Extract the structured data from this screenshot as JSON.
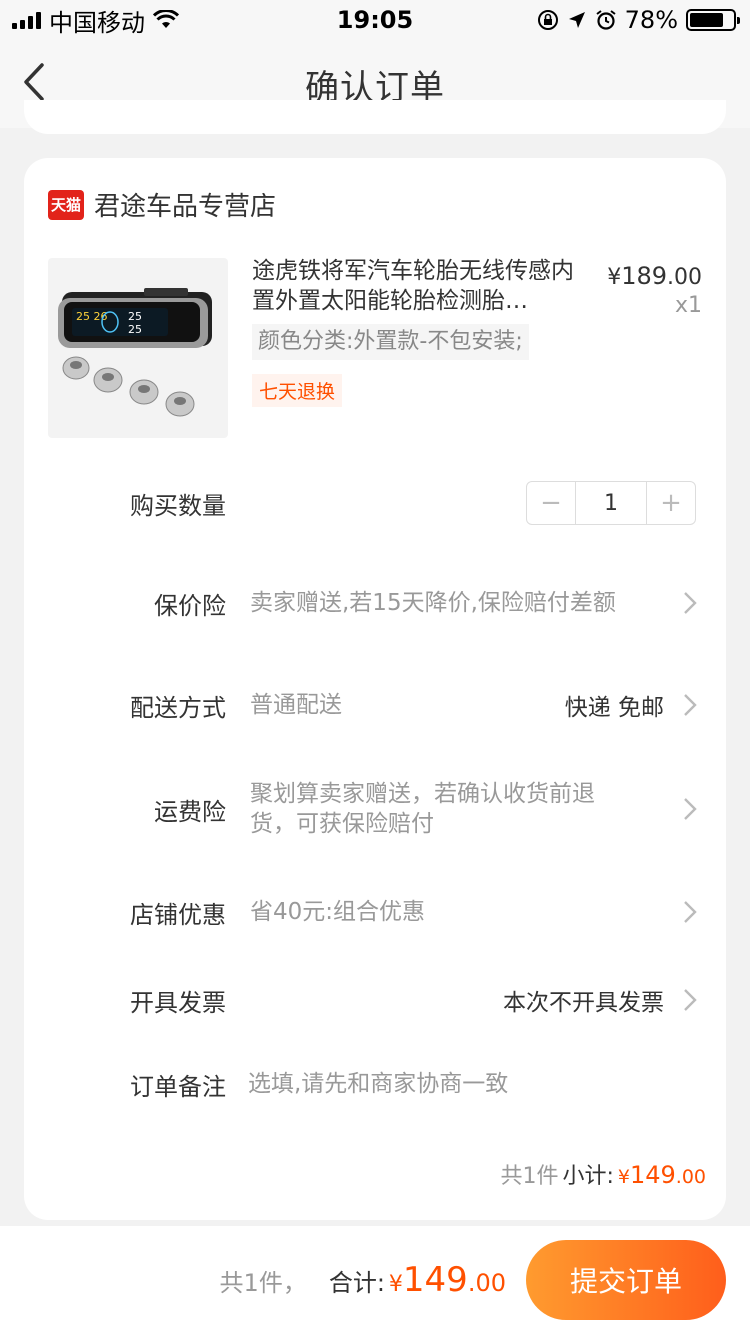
{
  "status_bar": {
    "carrier": "中国移动",
    "time": "19:05",
    "battery": "78%",
    "battery_level": 0.78
  },
  "nav": {
    "title": "确认订单"
  },
  "shop": {
    "badge": "天猫",
    "name": "君途车品专营店"
  },
  "product": {
    "title": "途虎铁将军汽车轮胎无线传感内置外置太阳能轮胎检测胎…",
    "price_currency": "¥",
    "price_int": "189",
    "price_dec": ".00",
    "quantity": "x1",
    "sku": "颜色分类:外置款-不包安装;",
    "return_tag": "七天退换"
  },
  "rows": {
    "quantity": {
      "label": "购买数量",
      "value": "1",
      "minus": "−",
      "plus": "+"
    },
    "price_protect": {
      "label": "保价险",
      "desc": "卖家赠送,若15天降价,保险赔付差额"
    },
    "delivery": {
      "label": "配送方式",
      "desc": "普通配送",
      "value": "快递 免邮"
    },
    "shipping_insurance": {
      "label": "运费险",
      "desc": "聚划算卖家赠送，若确认收货前退货，可获保险赔付"
    },
    "store_discount": {
      "label": "店铺优惠",
      "desc": "省40元:组合优惠"
    },
    "invoice": {
      "label": "开具发票",
      "value": "本次不开具发票"
    },
    "note": {
      "label": "订单备注",
      "placeholder": "选填,请先和商家协商一致"
    }
  },
  "subtotal": {
    "count": "共1件",
    "label": "小计:",
    "currency": "¥",
    "int": "149",
    "dec": ".00"
  },
  "bottom": {
    "count": "共1件，",
    "label": "合计:",
    "currency": "¥",
    "int": "149",
    "dec": ".00",
    "submit": "提交订单"
  },
  "colors": {
    "accent": "#ff5000",
    "tmall_red": "#e2231a"
  }
}
